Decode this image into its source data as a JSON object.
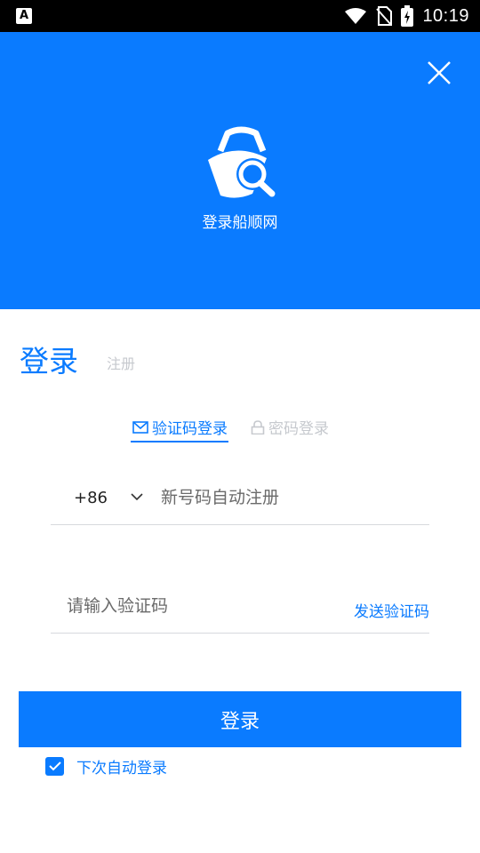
{
  "status_bar": {
    "left_icon": "A",
    "time": "10:19",
    "icons": [
      "notification-a-icon",
      "wifi-icon",
      "no-sim-icon",
      "battery-charging-icon"
    ]
  },
  "header": {
    "close_icon": "close-icon",
    "logo_icon": "shopping-bag-search-logo",
    "title": "登录船顺网",
    "background": "#0a7bff"
  },
  "tabs": {
    "login": "登录",
    "register": "注册"
  },
  "methods": {
    "sms": {
      "label": "验证码登录",
      "icon": "mail-icon",
      "active": true
    },
    "password": {
      "label": "密码登录",
      "icon": "lock-icon",
      "active": false
    }
  },
  "phone": {
    "country_code": "+86",
    "placeholder": "新号码自动注册",
    "value": ""
  },
  "code": {
    "placeholder": "请输入验证码",
    "value": "",
    "send_label": "发送验证码"
  },
  "submit": {
    "label": "登录"
  },
  "auto_login": {
    "label": "下次自动登录",
    "checked": true
  },
  "colors": {
    "accent": "#0a7bff",
    "inactive": "#c6c9ce",
    "divider": "#d7d9dd"
  }
}
